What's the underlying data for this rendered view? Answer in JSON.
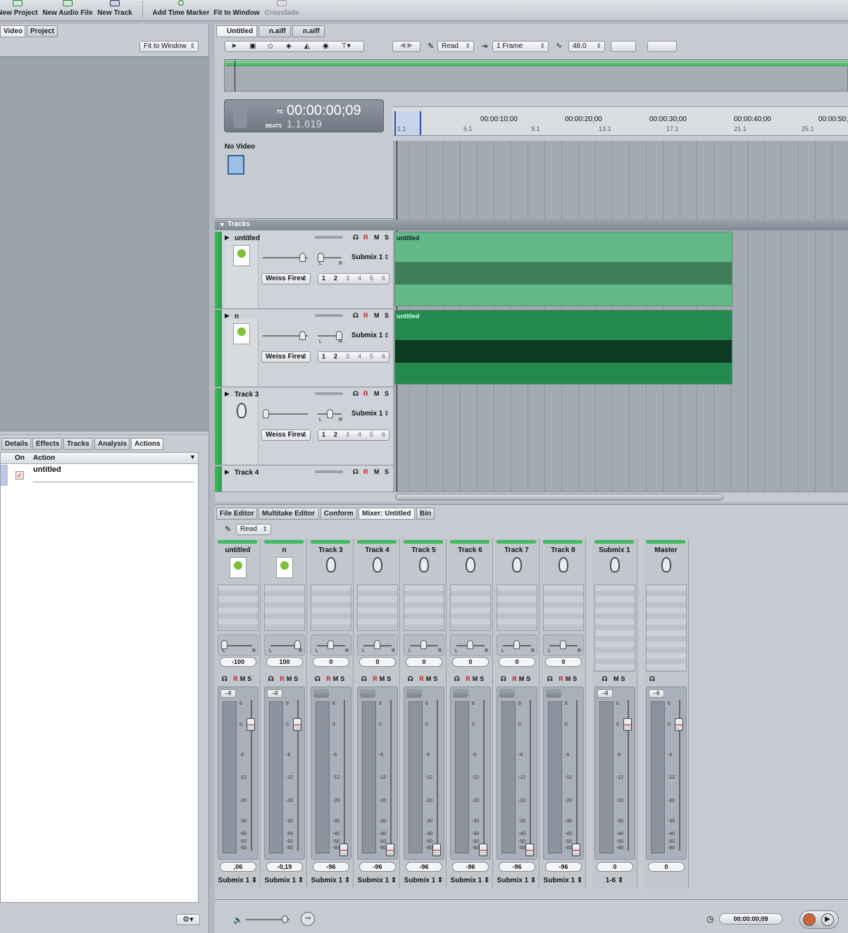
{
  "toolbar": {
    "new_project": "New Project",
    "new_audio_file": "New Audio File",
    "new_track": "New Track",
    "add_time_marker": "Add Time Marker",
    "fit_to_window": "Fit to Window",
    "crossfade": "Crossfade"
  },
  "left": {
    "tab_video": "Video",
    "tab_project": "Project",
    "fit_popup": "Fit to Window",
    "bottom_tabs": [
      "Details",
      "Effects",
      "Tracks",
      "Analysis",
      "Actions"
    ],
    "actions": {
      "col_on": "On",
      "col_action": "Action",
      "row1": "untitled"
    }
  },
  "project": {
    "doc_tabs": [
      "Untitled",
      "n.aiff",
      "n.aiff"
    ],
    "automation": "Read",
    "frame": "1 Frame",
    "zoom": "48.0",
    "timecode": "00:00:00;09",
    "tc_label": "TC",
    "beats_label": "BEATS",
    "beats": "1.1.619",
    "ruler_times": [
      "00:00:10;00",
      "00:00:20;00",
      "00:00:30;00",
      "00:00:40;00",
      "00:00:50;"
    ],
    "ruler_beats": [
      "1.1",
      "5.1",
      "9.1",
      "13.1",
      "17.1",
      "21.1",
      "25.1"
    ],
    "no_video": "No Video",
    "tracks_label": "Tracks",
    "tracks": [
      {
        "name": "untitled",
        "output": "Submix 1",
        "effect": "Weiss Firev",
        "region": "untitled",
        "type": "aiff"
      },
      {
        "name": "n",
        "output": "Submix 1",
        "effect": "Weiss Firev",
        "region": "untitled",
        "type": "aiff"
      },
      {
        "name": "Track 3",
        "output": "Submix 1",
        "effect": "Weiss Firev",
        "region": "",
        "type": "speaker"
      },
      {
        "name": "Track 4",
        "output": "Submix 1",
        "effect": "",
        "region": "",
        "type": "speaker"
      }
    ],
    "channels": [
      "1",
      "2",
      "3",
      "4",
      "5",
      "6"
    ],
    "r": "R",
    "m": "M",
    "s": "S",
    "pan_l": "L",
    "pan_r": "R"
  },
  "editor": {
    "tabs": [
      "File Editor",
      "Multitake Editor",
      "Conform",
      "Mixer: Untitled",
      "Bin"
    ],
    "automation": "Read",
    "strips": [
      {
        "name": "untitled",
        "pan": "-100",
        "fader": ",06",
        "out": "Submix 1",
        "btn": "–8",
        "icon": "aiff"
      },
      {
        "name": "n",
        "pan": "100",
        "fader": "-0,19",
        "out": "Submix 1",
        "btn": "–8",
        "icon": "aiff"
      },
      {
        "name": "Track 3",
        "pan": "0",
        "fader": "-96",
        "out": "Submix 1",
        "btn": "",
        "icon": "speaker"
      },
      {
        "name": "Track 4",
        "pan": "0",
        "fader": "-96",
        "out": "Submix 1",
        "btn": "",
        "icon": "speaker"
      },
      {
        "name": "Track 5",
        "pan": "0",
        "fader": "-96",
        "out": "Submix 1",
        "btn": "",
        "icon": "speaker"
      },
      {
        "name": "Track 6",
        "pan": "0",
        "fader": "-96",
        "out": "Submix 1",
        "btn": "",
        "icon": "speaker"
      },
      {
        "name": "Track 7",
        "pan": "0",
        "fader": "-96",
        "out": "Submix 1",
        "btn": "",
        "icon": "speaker"
      },
      {
        "name": "Track 8",
        "pan": "0",
        "fader": "-96",
        "out": "Submix 1",
        "btn": "",
        "icon": "speaker"
      },
      {
        "name": "Submix 1",
        "pan": "",
        "fader": "0",
        "out": "1-6",
        "btn": "–8",
        "icon": "speaker"
      },
      {
        "name": "Master",
        "pan": "",
        "fader": "0",
        "out": "",
        "btn": "–8",
        "icon": "speaker"
      }
    ],
    "meter_scale": [
      "6",
      "0",
      "-6",
      "-12",
      "-20",
      "-30",
      "-40",
      "-50",
      "-60"
    ],
    "transport_time": "00:00:00;09"
  },
  "colors": {
    "track_green": "#3bbd5a",
    "region_light": "#63b887",
    "region_dark": "#23894f"
  }
}
